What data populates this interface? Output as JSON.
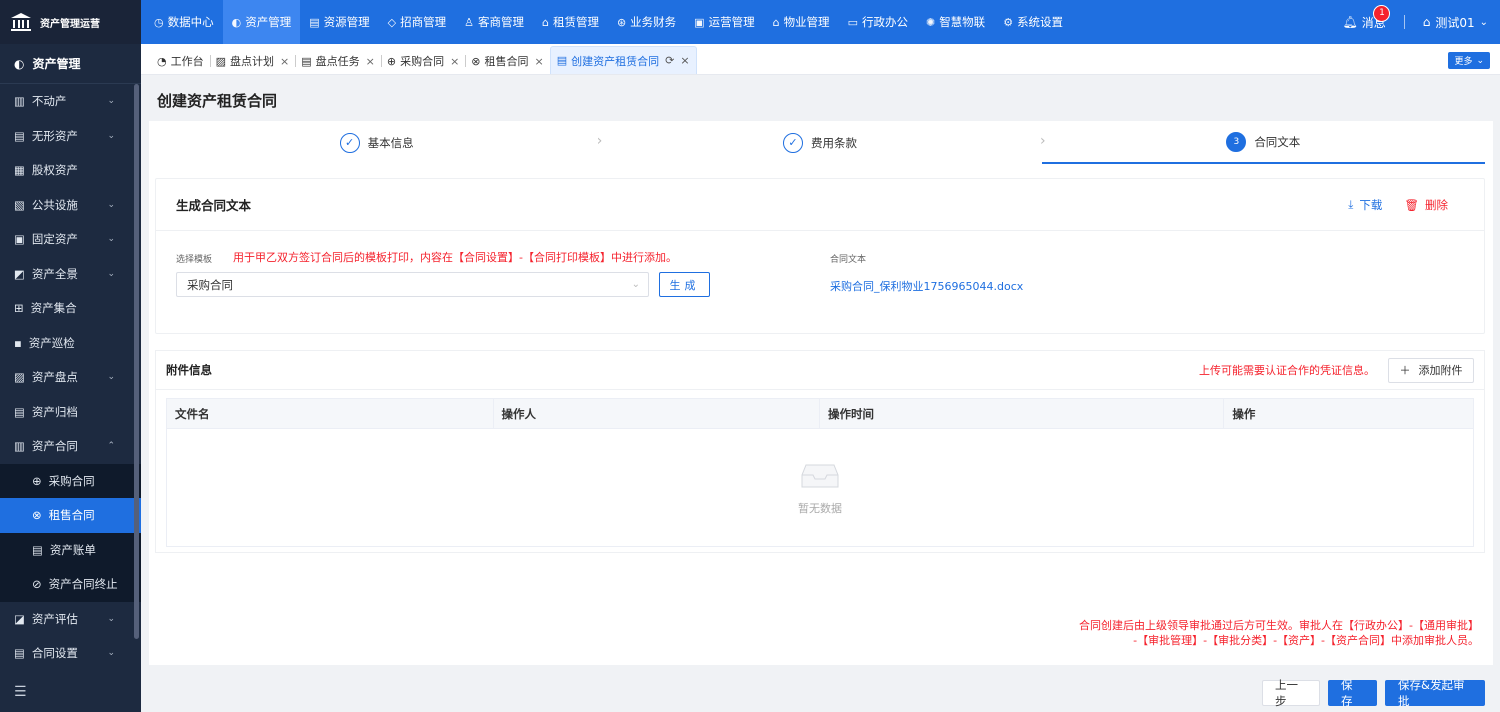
{
  "brand": {
    "name": "资产管理运营"
  },
  "topnav": [
    {
      "label": "数据中心",
      "icon": "clock-icon",
      "glyph": "◷"
    },
    {
      "label": "资产管理",
      "icon": "pie-icon",
      "glyph": "◐"
    },
    {
      "label": "资源管理",
      "icon": "building-icon",
      "glyph": "▤"
    },
    {
      "label": "招商管理",
      "icon": "tag-icon",
      "glyph": "◇"
    },
    {
      "label": "客商管理",
      "icon": "users-icon",
      "glyph": "♙"
    },
    {
      "label": "租赁管理",
      "icon": "house-icon",
      "glyph": "⌂"
    },
    {
      "label": "业务财务",
      "icon": "money-icon",
      "glyph": "⊛"
    },
    {
      "label": "运营管理",
      "icon": "chart-icon",
      "glyph": "▣"
    },
    {
      "label": "物业管理",
      "icon": "home-icon",
      "glyph": "⌂"
    },
    {
      "label": "行政办公",
      "icon": "monitor-icon",
      "glyph": "▭"
    },
    {
      "label": "智慧物联",
      "icon": "iot-icon",
      "glyph": "✺"
    },
    {
      "label": "系统设置",
      "icon": "settings-icon",
      "glyph": "⚙"
    }
  ],
  "topright": {
    "message_label": "消息",
    "message_count": "1",
    "user_label": "测试01"
  },
  "sidebar": {
    "header": "资产管理",
    "items": [
      {
        "label": "不动产",
        "icon": "building-icon",
        "glyph": "▥",
        "chev": "⌄"
      },
      {
        "label": "无形资产",
        "icon": "doc-icon",
        "glyph": "▤",
        "chev": "⌄"
      },
      {
        "label": "股权资产",
        "icon": "stack-icon",
        "glyph": "▦",
        "chev": ""
      },
      {
        "label": "公共设施",
        "icon": "facility-icon",
        "glyph": "▧",
        "chev": "⌄"
      },
      {
        "label": "固定资产",
        "icon": "box-icon",
        "glyph": "▣",
        "chev": "⌄"
      },
      {
        "label": "资产全景",
        "icon": "panorama-icon",
        "glyph": "◩",
        "chev": "⌄"
      },
      {
        "label": "资产集合",
        "icon": "grid-icon",
        "glyph": "⊞",
        "chev": ""
      },
      {
        "label": "资产巡检",
        "icon": "inspect-icon",
        "glyph": "▪",
        "chev": ""
      },
      {
        "label": "资产盘点",
        "icon": "calendar-icon",
        "glyph": "▨",
        "chev": "⌄"
      },
      {
        "label": "资产归档",
        "icon": "archive-icon",
        "glyph": "▤",
        "chev": ""
      },
      {
        "label": "资产合同",
        "icon": "contract-icon",
        "glyph": "▥",
        "chev": "⌃"
      }
    ],
    "submenu": [
      {
        "label": "采购合同",
        "icon": "cart-icon",
        "glyph": "⊕"
      },
      {
        "label": "租售合同",
        "icon": "handshake-icon",
        "glyph": "⊗"
      },
      {
        "label": "资产账单",
        "icon": "bill-icon",
        "glyph": "▤"
      },
      {
        "label": "资产合同终止",
        "icon": "stop-icon",
        "glyph": "⊘"
      }
    ],
    "items_after": [
      {
        "label": "资产评估",
        "icon": "assess-icon",
        "glyph": "◪",
        "chev": "⌄"
      },
      {
        "label": "合同设置",
        "icon": "config-icon",
        "glyph": "▤",
        "chev": "⌄"
      }
    ]
  },
  "tabs": [
    {
      "label": "工作台",
      "icon": "dashboard-icon",
      "glyph": "◔",
      "closable": false
    },
    {
      "label": "盘点计划",
      "icon": "calendar-icon",
      "glyph": "▨",
      "closable": true
    },
    {
      "label": "盘点任务",
      "icon": "task-icon",
      "glyph": "▤",
      "closable": true
    },
    {
      "label": "采购合同",
      "icon": "cart-icon",
      "glyph": "⊕",
      "closable": true
    },
    {
      "label": "租售合同",
      "icon": "handshake-icon",
      "glyph": "⊗",
      "closable": true
    },
    {
      "label": "创建资产租赁合同",
      "icon": "form-icon",
      "glyph": "▤",
      "closable": true,
      "active": true
    }
  ],
  "more_label": "更多",
  "page": {
    "title": "创建资产租赁合同"
  },
  "steps": [
    {
      "label": "基本信息",
      "mark": "✓"
    },
    {
      "label": "费用条款",
      "mark": "✓"
    },
    {
      "label": "合同文本",
      "mark": "3"
    }
  ],
  "generate": {
    "title": "生成合同文本",
    "download_label": "下载",
    "delete_label": "删除",
    "template_label": "选择模板",
    "template_hint": "用于甲乙双方签订合同后的模板打印，内容在【合同设置】-【合同打印模板】中进行添加。",
    "template_value": "采购合同",
    "generate_btn": "生成",
    "contract_text_label": "合同文本",
    "contract_file": "采购合同_保利物业1756965044.docx"
  },
  "attachments": {
    "title": "附件信息",
    "hint": "上传可能需要认证合作的凭证信息。",
    "add_btn": "添加附件",
    "columns": [
      "文件名",
      "操作人",
      "操作时间",
      "操作"
    ],
    "empty_text": "暂无数据"
  },
  "approve_note_line1": "合同创建后由上级领导审批通过后方可生效。审批人在【行政办公】-【通用审批】",
  "approve_note_line2": "-【审批管理】-【审批分类】-【资产】-【资产合同】中添加审批人员。",
  "footer": {
    "prev": "上一步",
    "save": "保存",
    "submit": "保存&发起审批"
  },
  "colors": {
    "primary": "#1f6fe0",
    "sidebar": "#1d2a40",
    "danger": "#f5222d"
  }
}
